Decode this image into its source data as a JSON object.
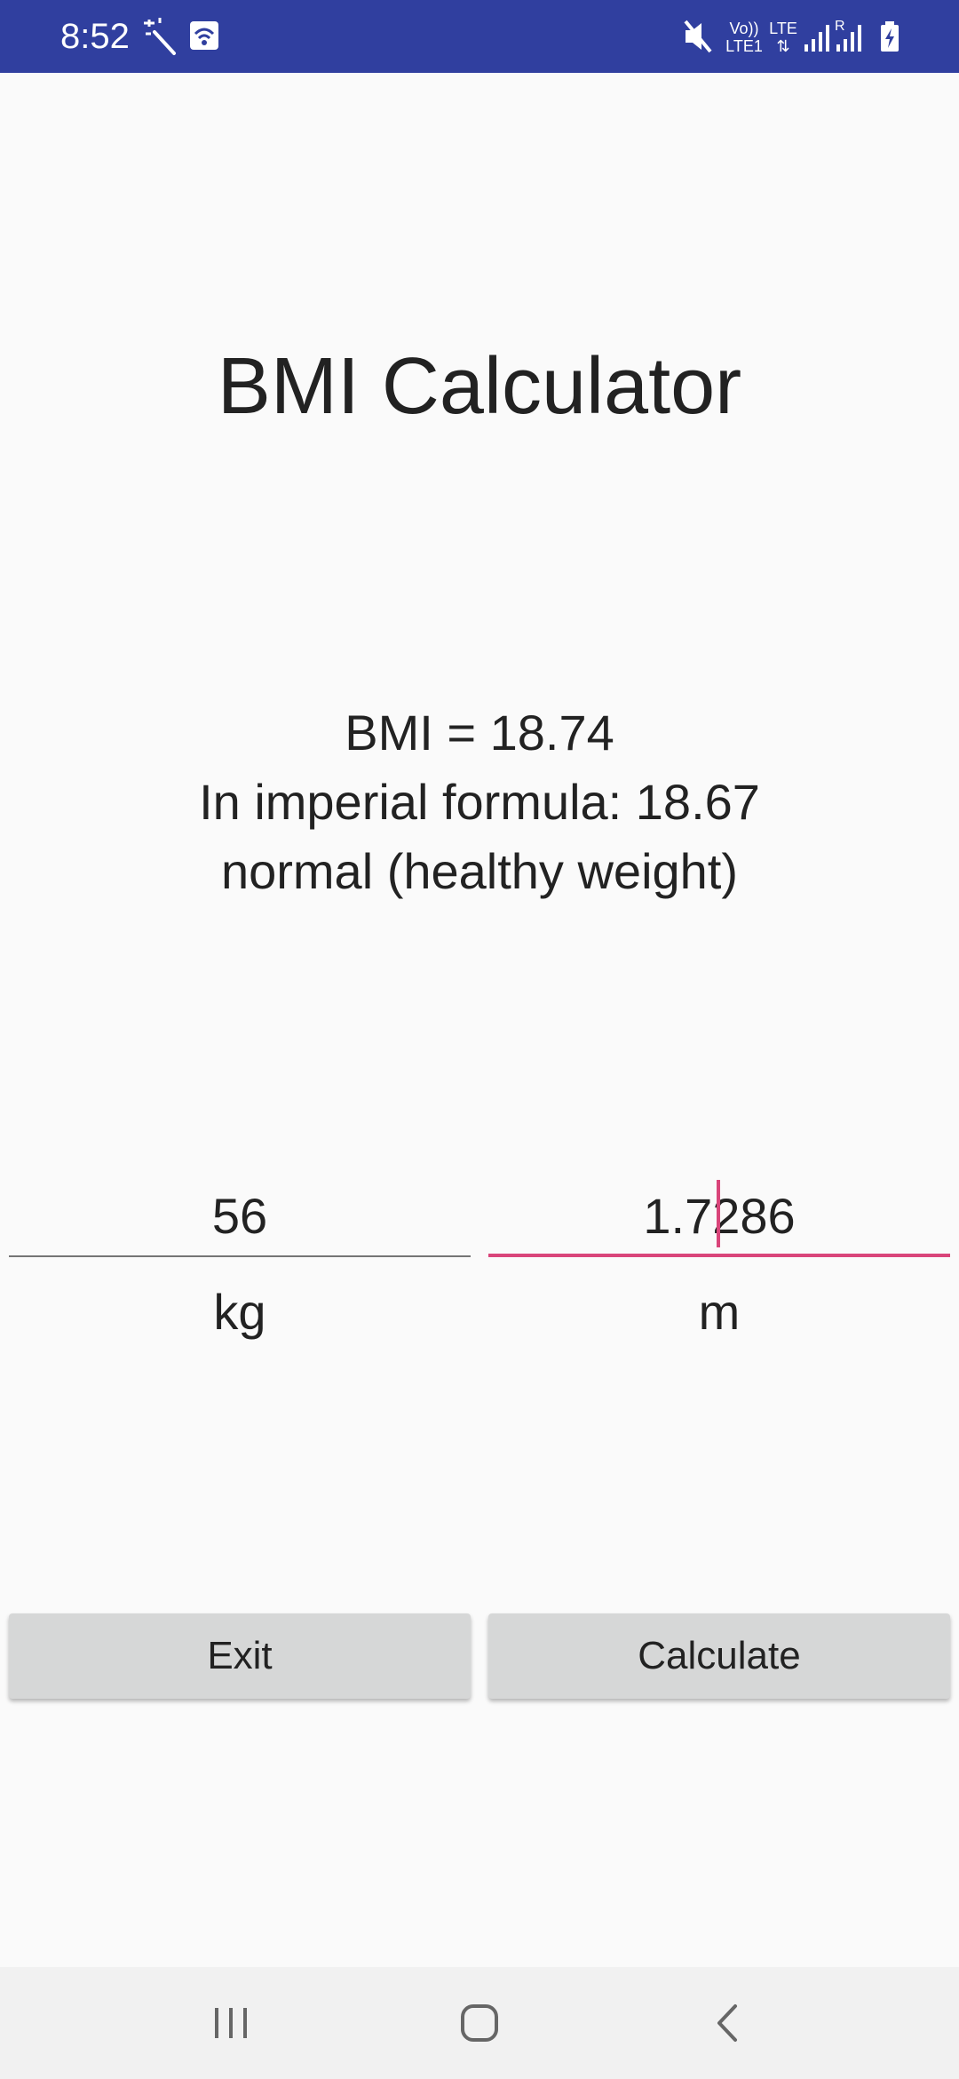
{
  "status_bar": {
    "time": "8:52",
    "background_color": "#303f9f",
    "left_icons": [
      "magic-wand-icon",
      "wifi-calling-icon"
    ],
    "right_icons": [
      "mute-icon",
      "volte-icon",
      "lte-data-icon",
      "signal-icon",
      "roaming-signal-icon",
      "battery-charging-icon"
    ],
    "volte_label_top": "Vo))",
    "volte_label_bottom": "LTE1",
    "lte_label": "LTE",
    "roaming_label": "R"
  },
  "app": {
    "title": "BMI Calculator",
    "result": {
      "bmi_line": "BMI = 18.74",
      "imperial_line": "In imperial formula: 18.67",
      "category_line": "normal (healthy weight)"
    },
    "weight": {
      "value": "56",
      "unit": "kg"
    },
    "height": {
      "value": "1.7286",
      "unit": "m",
      "focused": true
    },
    "buttons": {
      "exit_label": "Exit",
      "calculate_label": "Calculate"
    },
    "accent_color": "#d9457a",
    "button_color": "#d6d7d7"
  },
  "nav_bar": {
    "buttons": [
      "recent-apps-icon",
      "home-icon",
      "back-icon"
    ]
  }
}
